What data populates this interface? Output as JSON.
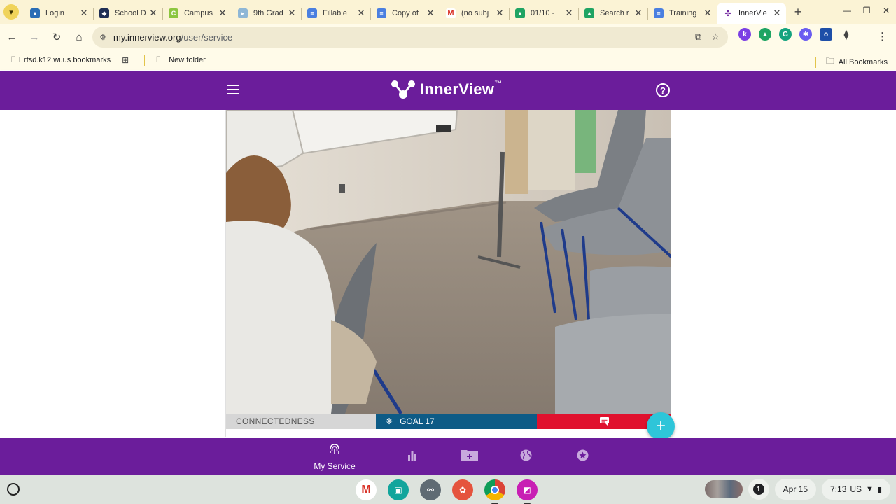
{
  "browser": {
    "tabs": [
      {
        "title": "Login",
        "favicon": "account-icon",
        "color": "#2a6db5"
      },
      {
        "title": "School D",
        "favicon": "school-shield-icon",
        "color": "#1f2e55"
      },
      {
        "title": "Campus",
        "favicon": "campus-icon",
        "color": "#8cc63f"
      },
      {
        "title": "9th Grad",
        "favicon": "slides-icon",
        "color": "#8fb7d6"
      },
      {
        "title": "Fillable",
        "favicon": "docs-icon",
        "color": "#4a7fe0"
      },
      {
        "title": "Copy of",
        "favicon": "docs-icon",
        "color": "#4a7fe0"
      },
      {
        "title": "(no subj",
        "favicon": "gmail-icon",
        "color": "#d93025"
      },
      {
        "title": "01/10 -",
        "favicon": "drive-icon",
        "color": "#1fa463"
      },
      {
        "title": "Search r",
        "favicon": "drive-icon",
        "color": "#1fa463"
      },
      {
        "title": "Training",
        "favicon": "docs-icon",
        "color": "#4a7fe0"
      },
      {
        "title": "InnerVie",
        "favicon": "innerview-icon",
        "color": "#6b1d9b",
        "active": true
      }
    ],
    "url_host": "my.innerview.org",
    "url_path": "/user/service",
    "bookmarks": [
      {
        "label": "rfsd.k12.wi.us bookmarks"
      },
      {
        "label": "New folder"
      }
    ],
    "all_bookmarks": "All Bookmarks"
  },
  "app": {
    "brand_name": "InnerView",
    "brand_tm": "™"
  },
  "post": {
    "tag_category": "CONNECTEDNESS",
    "tag_goal": "GOAL 17"
  },
  "bottom_nav": [
    {
      "label": "My Service",
      "icon": "fingerprint-icon",
      "active": true
    },
    {
      "label": "",
      "icon": "bar-chart-icon"
    },
    {
      "label": "",
      "icon": "folder-add-icon"
    },
    {
      "label": "",
      "icon": "globe-icon"
    },
    {
      "label": "",
      "icon": "star-icon"
    }
  ],
  "shelf": {
    "date": "Apr 15",
    "time": "7:13",
    "locale": "US",
    "notification_count": "1"
  },
  "colors": {
    "brand_purple": "#6b1d9b",
    "goal_blue": "#0d5b86",
    "comment_red": "#e0112e",
    "fab_cyan": "#2ec5d9"
  }
}
